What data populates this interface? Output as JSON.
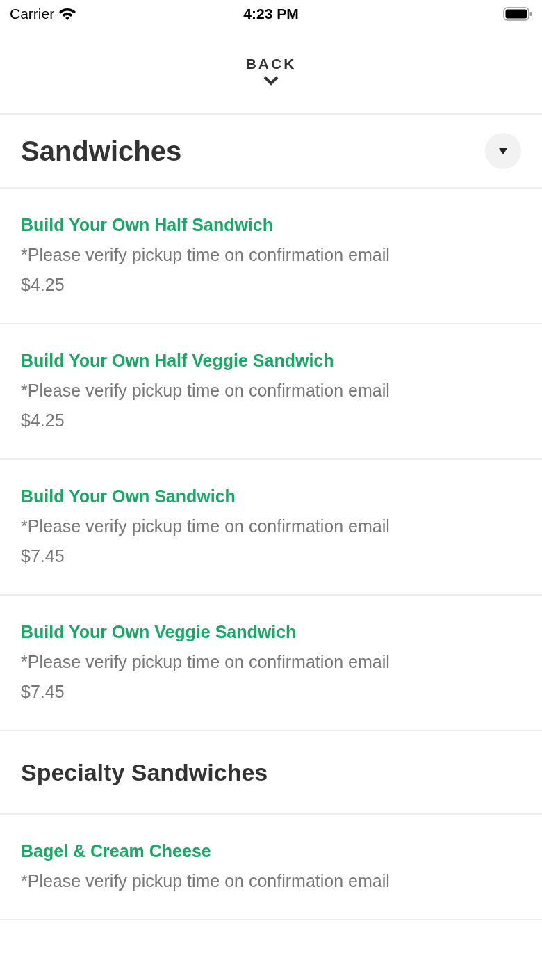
{
  "status_bar": {
    "carrier": "Carrier",
    "time": "4:23 PM"
  },
  "header": {
    "back_label": "BACK"
  },
  "sections": [
    {
      "title": "Sandwiches",
      "has_dropdown": true,
      "items": [
        {
          "name": "Build Your Own Half Sandwich",
          "note": "*Please verify pickup time on confirmation email",
          "price": "$4.25"
        },
        {
          "name": "Build Your Own Half Veggie Sandwich",
          "note": "*Please verify pickup time on confirmation email",
          "price": "$4.25"
        },
        {
          "name": "Build Your Own Sandwich",
          "note": "*Please verify pickup time on confirmation email",
          "price": "$7.45"
        },
        {
          "name": "Build Your Own Veggie Sandwich",
          "note": "*Please verify pickup time on confirmation email",
          "price": "$7.45"
        }
      ]
    },
    {
      "title": "Specialty Sandwiches",
      "has_dropdown": false,
      "items": [
        {
          "name": "Bagel & Cream Cheese",
          "note": "*Please verify pickup time on confirmation email"
        }
      ]
    }
  ]
}
